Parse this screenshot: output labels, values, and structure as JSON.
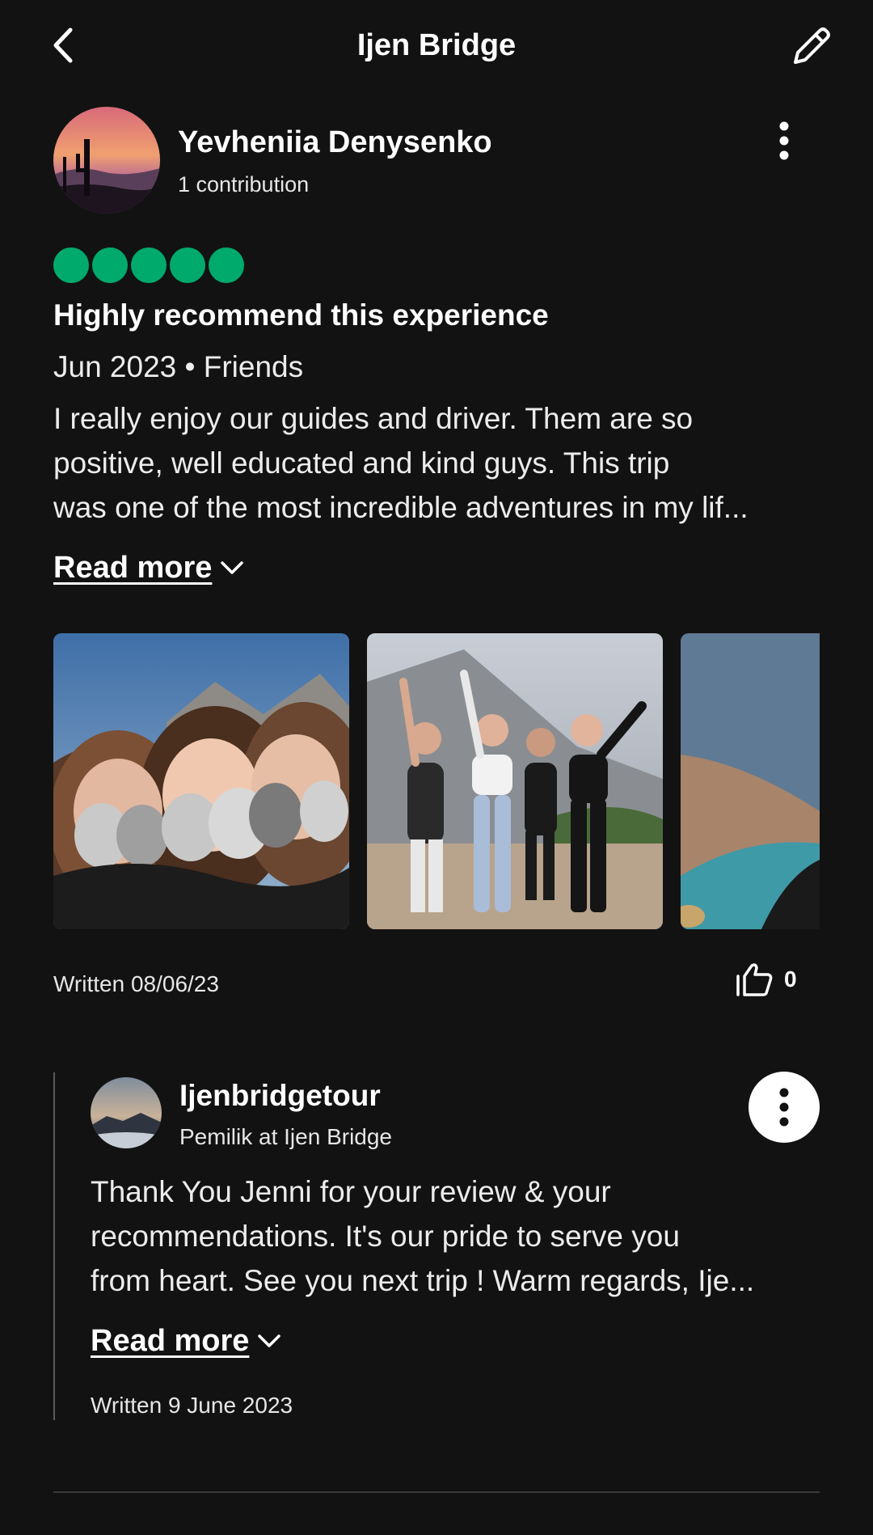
{
  "header": {
    "title": "Ijen Bridge"
  },
  "reviewer": {
    "name": "Yevheniia Denysenko",
    "contributions": "1 contribution"
  },
  "review": {
    "rating": 5,
    "rating_max": 5,
    "rating_color": "#00aa6c",
    "title": "Highly recommend this experience",
    "meta": "Jun 2023 • Friends",
    "text_lines": [
      "I really enjoy our guides and driver. Them are so",
      "positive, well educated and kind guys. This trip",
      "was one of the most incredible adventures in my lif..."
    ],
    "read_more": "Read more",
    "written": "Written 08/06/23",
    "helpful_count": "0"
  },
  "photos": [
    {
      "icon": "group-selfie-gas-masks-photo"
    },
    {
      "icon": "group-cheering-photo"
    },
    {
      "icon": "crater-lake-photo"
    }
  ],
  "owner_response": {
    "name": "Ijenbridgetour",
    "role": "Pemilik at Ijen Bridge",
    "text_lines": [
      "Thank You Jenni for your review & your",
      "recommendations. It's our pride to serve you",
      "from heart. See you next trip ! Warm regards, Ije..."
    ],
    "read_more": "Read more",
    "written": "Written 9 June 2023"
  },
  "colors": {
    "background": "#121212",
    "accent_green": "#00aa6c",
    "text": "#ffffff"
  }
}
